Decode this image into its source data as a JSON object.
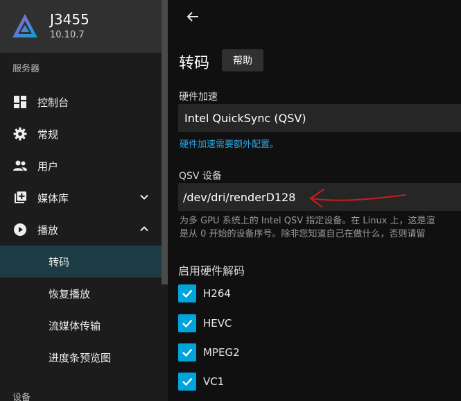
{
  "server": {
    "name": "J3455",
    "version": "10.10.7"
  },
  "sidebar": {
    "section_server": "服务器",
    "items": [
      {
        "label": "控制台",
        "icon": "dashboard-icon"
      },
      {
        "label": "常规",
        "icon": "gear-icon"
      },
      {
        "label": "用户",
        "icon": "users-icon"
      },
      {
        "label": "媒体库",
        "icon": "library-add-icon",
        "expanded": false
      },
      {
        "label": "播放",
        "icon": "play-circle-icon",
        "expanded": true
      }
    ],
    "subitems": [
      {
        "label": "转码",
        "active": true
      },
      {
        "label": "恢复播放",
        "active": false
      },
      {
        "label": "流媒体传输",
        "active": false
      },
      {
        "label": "进度条预览图",
        "active": false
      }
    ],
    "section_devices": "设备"
  },
  "page": {
    "title": "转码",
    "help_label": "帮助",
    "hw_accel_label": "硬件加速",
    "hw_accel_value": "Intel QuickSync (QSV)",
    "hw_accel_hint": "硬件加速需要额外配置。",
    "qsv_device_label": "QSV 设备",
    "qsv_device_value": "/dev/dri/renderD128",
    "qsv_desc_line1": "为多 GPU 系统上的 Intel QSV 指定设备。在 Linux 上，这是渲",
    "qsv_desc_line2": "是从 0 开始的设备序号。除非您知道自己在做什么，否则请留",
    "hw_decode_label": "启用硬件解码",
    "codecs": [
      {
        "label": "H264",
        "checked": true
      },
      {
        "label": "HEVC",
        "checked": true
      },
      {
        "label": "MPEG2",
        "checked": true
      },
      {
        "label": "VC1",
        "checked": true
      }
    ]
  },
  "colors": {
    "accent": "#00a4dc",
    "link": "#29a6e8",
    "annotation": "#cc1c1c"
  }
}
